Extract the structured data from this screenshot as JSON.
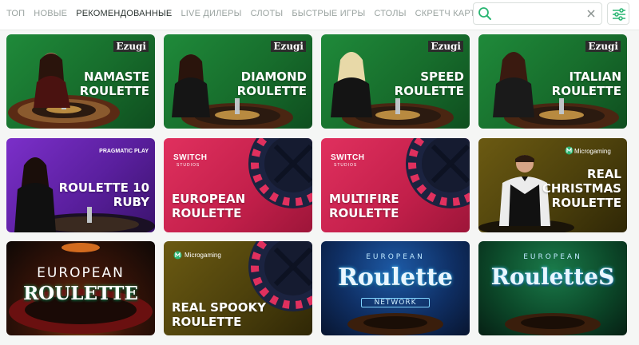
{
  "nav": {
    "items": [
      {
        "label": "ТОП",
        "active": false
      },
      {
        "label": "НОВЫЕ",
        "active": false
      },
      {
        "label": "РЕКОМЕНДОВАННЫЕ",
        "active": true
      },
      {
        "label": "LIVE ДИЛЕРЫ",
        "active": false
      },
      {
        "label": "СЛОТЫ",
        "active": false
      },
      {
        "label": "БЫСТРЫЕ ИГРЫ",
        "active": false
      },
      {
        "label": "СТОЛЫ",
        "active": false
      },
      {
        "label": "СКРЕТЧ КАРТЫ",
        "active": false
      }
    ]
  },
  "search": {
    "value": "",
    "placeholder": ""
  },
  "colors": {
    "accent": "#2bb673",
    "text_active": "#2c3532",
    "text_muted": "#9aa3a0"
  },
  "games": [
    {
      "title_lines": [
        "NAMASTE",
        "ROULETTE"
      ],
      "provider": "Ezugi",
      "theme": "green"
    },
    {
      "title_lines": [
        "DIAMOND",
        "ROULETTE"
      ],
      "provider": "Ezugi",
      "theme": "green"
    },
    {
      "title_lines": [
        "SPEED",
        "ROULETTE"
      ],
      "provider": "Ezugi",
      "theme": "green"
    },
    {
      "title_lines": [
        "ITALIAN",
        "ROULETTE"
      ],
      "provider": "Ezugi",
      "theme": "green"
    },
    {
      "title_lines": [
        "ROULETTE 10",
        "RUBY"
      ],
      "provider": "PRAGMATIC PLAY",
      "theme": "purple"
    },
    {
      "title_lines": [
        "EUROPEAN",
        "ROULETTE"
      ],
      "provider": "SWITCH",
      "provider_sub": "STUDIOS",
      "theme": "magenta"
    },
    {
      "title_lines": [
        "MULTIFIRE",
        "ROULETTE"
      ],
      "provider": "SWITCH",
      "provider_sub": "STUDIOS",
      "theme": "magenta"
    },
    {
      "title_lines": [
        "REAL",
        "CHRISTMAS",
        "ROULETTE"
      ],
      "provider": "Microgaming",
      "theme": "olive"
    },
    {
      "logo_top": "EUROPEAN",
      "logo_main": "ROULETTE",
      "theme": "red-logo"
    },
    {
      "title_lines": [
        "REAL SPOOKY",
        "ROULETTE"
      ],
      "provider": "Microgaming",
      "theme": "olive"
    },
    {
      "logo_top": "EUROPEAN",
      "logo_main": "Roulette",
      "logo_sub": "NETWORK",
      "theme": "blue-logo"
    },
    {
      "logo_top": "EUROPEAN",
      "logo_main": "RouletteS",
      "theme": "green-logo"
    }
  ]
}
